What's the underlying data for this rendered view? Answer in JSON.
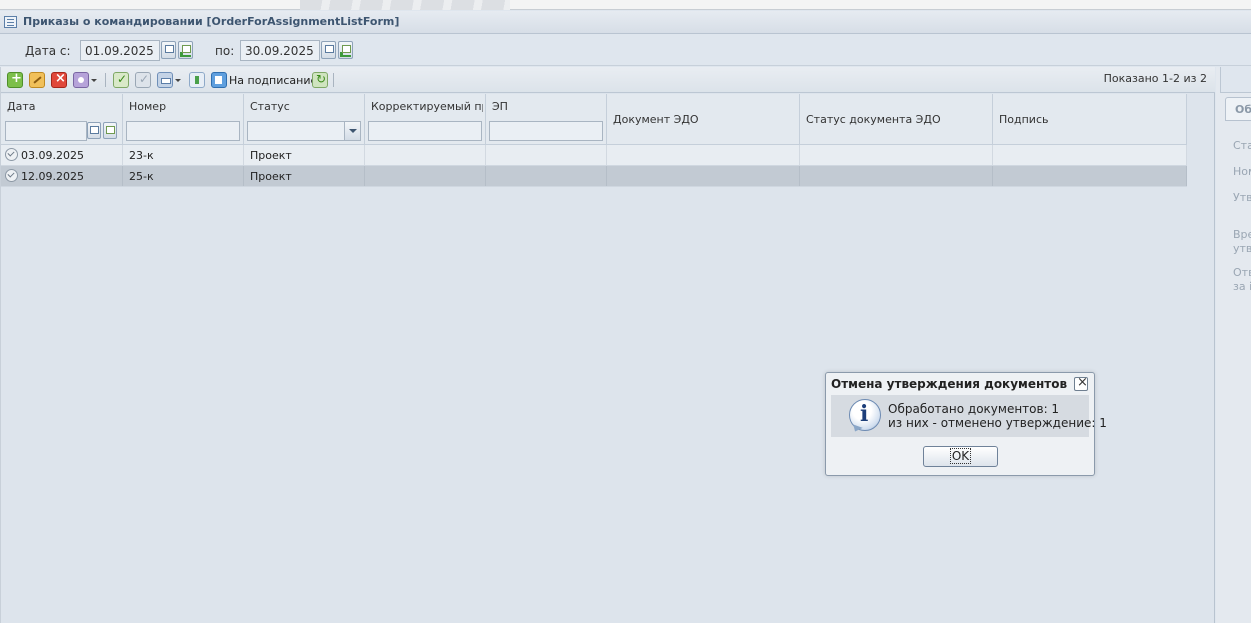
{
  "window": {
    "title": "Приказы о командировании [OrderForAssignmentListForm]"
  },
  "datebar": {
    "from_label": "Дата с:",
    "from_value": "01.09.2025",
    "to_label": "по:",
    "to_value": "30.09.2025"
  },
  "toolbar": {
    "sign_label": "На подписание",
    "shown_text": "Показано 1-2 из 2"
  },
  "grid": {
    "columns": [
      "Дата",
      "Номер",
      "Статус",
      "Корректируемый пр...",
      "ЭП",
      "Документ ЭДО",
      "Статус документа ЭДО",
      "Подпись"
    ],
    "rows": [
      {
        "date": "03.09.2025",
        "number": "23-к",
        "status": "Проект",
        "corrected": "",
        "ep": "",
        "edo_doc": "",
        "edo_status": "",
        "signature": ""
      },
      {
        "date": "12.09.2025",
        "number": "25-к",
        "status": "Проект",
        "corrected": "",
        "ep": "",
        "edo_doc": "",
        "edo_status": "",
        "signature": ""
      }
    ],
    "selected_row": 1
  },
  "right_panel": {
    "tab_label": "Об",
    "lines": [
      "Ста",
      "Ном",
      "Утв",
      "Вре",
      "утв",
      "Отв",
      "за і"
    ]
  },
  "dialog": {
    "title": "Отмена утверждения документов",
    "line1": "Обработано документов: 1",
    "line2": "из них - отменено утверждение: 1",
    "ok_label": "OK"
  }
}
